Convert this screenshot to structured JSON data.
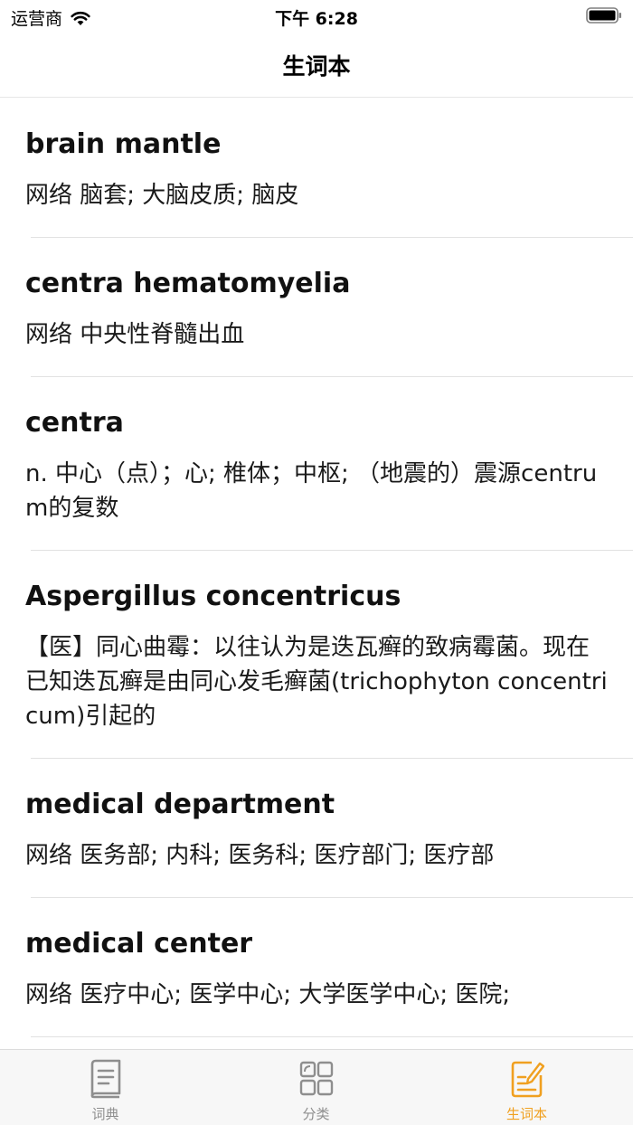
{
  "status_bar": {
    "carrier": "运营商",
    "time": "下午 6:28"
  },
  "nav": {
    "title": "生词本"
  },
  "entries": [
    {
      "word": "brain mantle",
      "definition": "网络  脑套; 大脑皮质; 脑皮"
    },
    {
      "word": "centra hematomyelia",
      "definition": "网络  中央性脊髓出血"
    },
    {
      "word": "centra",
      "definition": "n.  中心（点）；心; 椎体；中枢; （地震的）震源centrum的复数"
    },
    {
      "word": "Aspergillus concentricus",
      "definition": "【医】同心曲霉：以往认为是迭瓦癣的致病霉菌。现在已知迭瓦癣是由同心发毛癣菌(trichophyton concentricum)引起的"
    },
    {
      "word": "medical department",
      "definition": "网络  医务部; 内科; 医务科; 医疗部门; 医疗部"
    },
    {
      "word": "medical center",
      "definition": "网络  医疗中心; 医学中心; 大学医学中心; 医院;"
    }
  ],
  "tabs": [
    {
      "label": "词典",
      "icon": "book-icon"
    },
    {
      "label": "分类",
      "icon": "grid-icon"
    },
    {
      "label": "生词本",
      "icon": "notebook-edit-icon",
      "active": true
    }
  ],
  "colors": {
    "accent": "#f0a020",
    "inactive": "#8e8e8e"
  }
}
